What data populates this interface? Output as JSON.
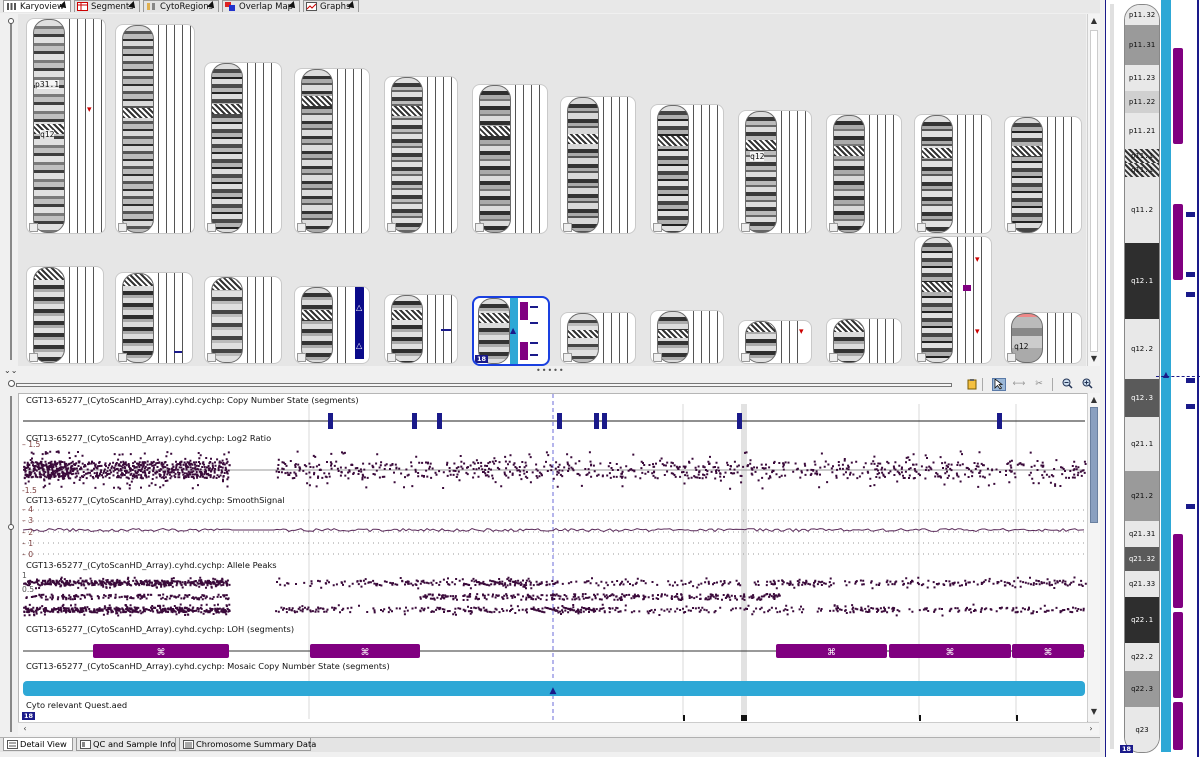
{
  "top_tabs": [
    {
      "label": "Karyoview",
      "icon": "karyogram-icon",
      "active": true
    },
    {
      "label": "Segments",
      "icon": "segments-table-icon",
      "active": false
    },
    {
      "label": "CytoRegions",
      "icon": "cytoregions-icon",
      "active": false
    },
    {
      "label": "Overlap Map",
      "icon": "overlap-map-icon",
      "active": false
    },
    {
      "label": "Graphs",
      "icon": "graphs-icon",
      "active": false
    }
  ],
  "karyoview": {
    "band_labels": {
      "chr1_p": "p31.1",
      "chr1_q": "q12",
      "chr9": "q12",
      "chr21": "q12"
    },
    "selected_chromosome_number": "18"
  },
  "detail": {
    "tracks": {
      "cn_state": "CGT13-65277_(CytoScanHD_Array).cyhd.cychp: Copy Number State (segments)",
      "log2": "CGT13-65277_(CytoScanHD_Array).cyhd.cychp: Log2 Ratio",
      "smooth": "CGT13-65277_(CytoScanHD_Array).cyhd.cychp: SmoothSignal",
      "allele": "CGT13-65277_(CytoScanHD_Array).cyhd.cychp: Allele Peaks",
      "loh": "CGT13-65277_(CytoScanHD_Array).cyhd.cychp: LOH (segments)",
      "mosaic": "CGT13-65277_(CytoScanHD_Array).cyhd.cychp: Mosaic Copy Number State (segments)",
      "cyto": "Cyto relevant Quest.aed"
    },
    "log2_ticks": {
      "top": "1.5",
      "bottom": "-1.5"
    },
    "smooth_ticks": [
      "4",
      "3",
      "2",
      "1",
      "0"
    ],
    "allele_ticks": {
      "top": "1",
      "mid": "0.5"
    },
    "chromosome_badge": "18"
  },
  "bottom_tabs": [
    {
      "label": "Detail View",
      "icon": "detail-view-icon",
      "active": true
    },
    {
      "label": "QC and Sample Info",
      "icon": "qc-sample-icon",
      "active": false
    },
    {
      "label": "Chromosome Summary Data",
      "icon": "summary-data-icon",
      "active": false
    }
  ],
  "ideogram": {
    "bands": [
      "p11.32",
      "p11.31",
      "p11.23",
      "p11.22",
      "p11.21",
      "p11.1",
      "q11.1",
      "q11.2",
      "q12.1",
      "q12.2",
      "q12.3",
      "q21.1",
      "q21.2",
      "q21.31",
      "q21.32",
      "q21.33",
      "q22.1",
      "q22.2",
      "q22.3",
      "q23"
    ],
    "chromosome_badge": "18"
  },
  "colors": {
    "accent": "#1a1a8a",
    "loh": "#800080",
    "mosaic": "#2ea8d6",
    "probe": "#3a0a3a"
  }
}
